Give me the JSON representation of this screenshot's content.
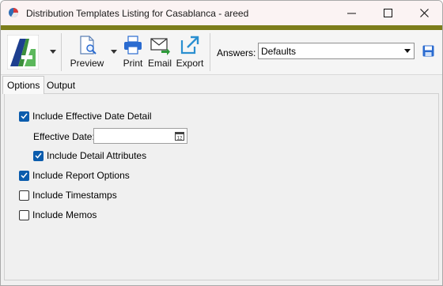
{
  "window": {
    "title": "Distribution Templates Listing for Casablanca - areed",
    "accent_color": "#7d7d1b"
  },
  "toolbar": {
    "preview_label": "Preview",
    "print_label": "Print",
    "email_label": "Email",
    "export_label": "Export",
    "answers_label": "Answers:",
    "answers_value": "Defaults"
  },
  "tabs": [
    {
      "label": "Options"
    },
    {
      "label": "Output"
    }
  ],
  "options": {
    "include_effective_date_detail": {
      "label": "Include Effective Date Detail",
      "checked": true
    },
    "effective_date": {
      "label": "Effective Date:",
      "value": ""
    },
    "include_detail_attributes": {
      "label": "Include Detail Attributes",
      "checked": true
    },
    "include_report_options": {
      "label": "Include Report Options",
      "checked": true
    },
    "include_timestamps": {
      "label": "Include Timestamps",
      "checked": false
    },
    "include_memos": {
      "label": "Include Memos",
      "checked": false
    }
  }
}
